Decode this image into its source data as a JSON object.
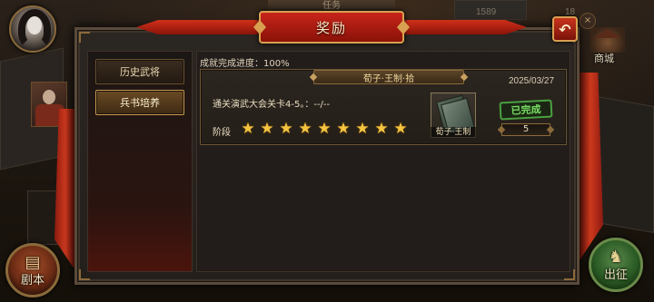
{
  "header": {
    "title": "奖励",
    "top_tab_label": "任务"
  },
  "hud": {
    "coin_value": "1589",
    "gem_value": "18"
  },
  "side_right": {
    "shop_label": "商城"
  },
  "bottom_buttons": {
    "script_label": "剧本",
    "battle_label": "出征"
  },
  "nav": {
    "items": [
      {
        "label": "历史武将",
        "active": false
      },
      {
        "label": "兵书培养",
        "active": true
      }
    ]
  },
  "achievement": {
    "progress_text": "成就完成进度：100%",
    "card": {
      "title": "荀子·王制·拾",
      "date": "2025/03/27",
      "description": "通关演武大会关卡4-5。：--/--",
      "stage_label": "阶段",
      "stars_filled": 9,
      "stars_total": 9,
      "reward_item_name": "荀子·王制",
      "status": "已完成",
      "reward_count": "5"
    }
  },
  "colors": {
    "accent_red": "#c8241a",
    "gold_border": "#d8a050",
    "star": "#f4c440",
    "done_green": "#7ad864"
  }
}
